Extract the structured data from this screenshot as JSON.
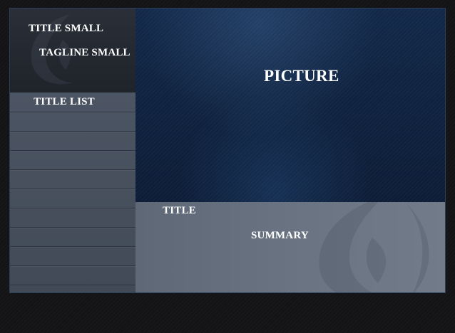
{
  "header": {
    "title_small": "TITLE SMALL",
    "tagline_small": "TAGLINE SMALL"
  },
  "list": {
    "header": "TITLE LIST",
    "rows": 9
  },
  "picture": {
    "label": "PICTURE"
  },
  "info": {
    "title": "TITLE",
    "summary": "SUMMARY"
  },
  "icons": {
    "header_emblem": "emblem-icon",
    "info_emblem": "emblem-icon"
  },
  "colors": {
    "background": "#141416",
    "picture_blue": "#13294a",
    "list_gray": "#4c5563",
    "info_gray": "#6a7482",
    "text": "#ffffff"
  }
}
